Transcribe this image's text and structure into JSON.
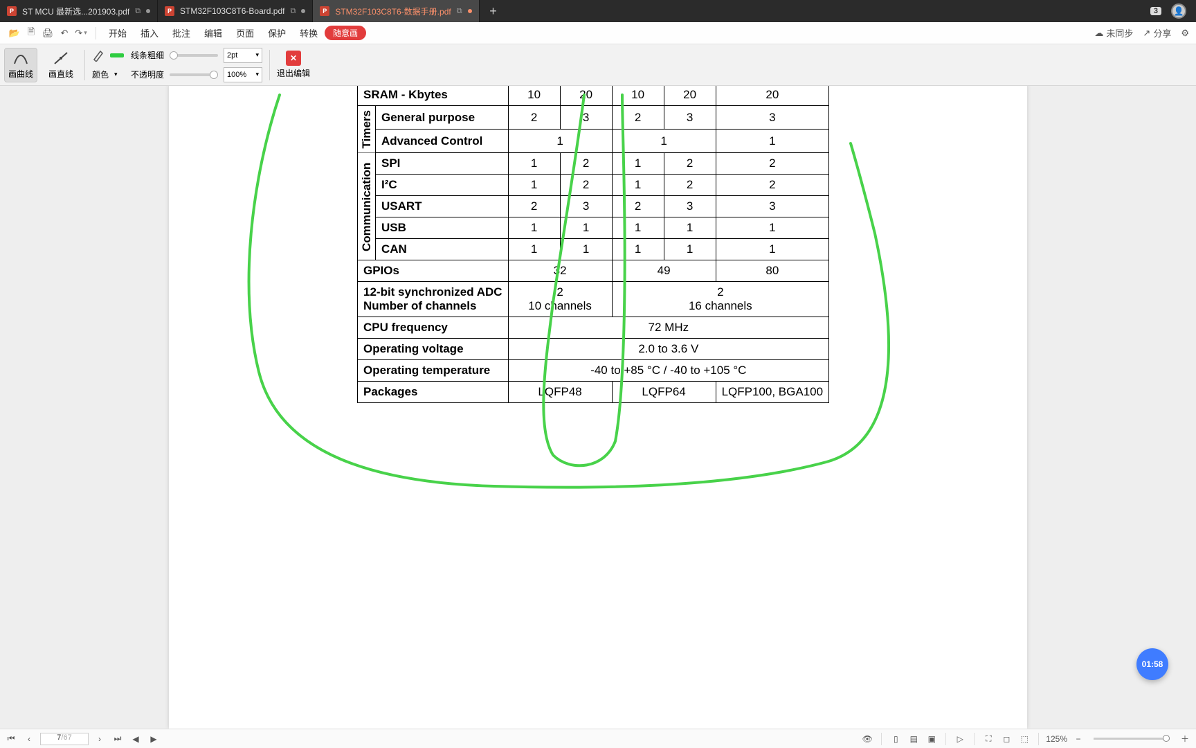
{
  "tabs": [
    {
      "label": "ST MCU 最新选...201903.pdf",
      "active": false,
      "modified": false
    },
    {
      "label": "STM32F103C8T6-Board.pdf",
      "active": false,
      "modified": false
    },
    {
      "label": "STM32F103C8T6-数据手册.pdf",
      "active": true,
      "modified": true
    }
  ],
  "titlebar_badge": "3",
  "menus": [
    "开始",
    "插入",
    "批注",
    "编辑",
    "页面",
    "保护",
    "转换"
  ],
  "pill": "随意画",
  "sync": "未同步",
  "share": "分享",
  "tools": {
    "curve": "画曲线",
    "line": "画直线",
    "color": "颜色",
    "opacity": "不透明度",
    "thickness_label": "线条粗细",
    "thickness": "2pt",
    "opacity_val": "100%",
    "exit": "退出编辑"
  },
  "table": {
    "sram": {
      "label": "SRAM - Kbytes",
      "v": [
        "10",
        "20",
        "10",
        "20",
        "20"
      ]
    },
    "timers_label": "Timers",
    "timers": [
      {
        "label": "General purpose",
        "v": [
          "2",
          "3",
          "2",
          "3",
          "3"
        ]
      },
      {
        "label": "Advanced Control",
        "v": [
          "1",
          "",
          "1",
          "",
          "1"
        ],
        "span": [
          2,
          0,
          1,
          0,
          1
        ],
        "merged": [
          true,
          false,
          false,
          false,
          false
        ]
      }
    ],
    "comm_label": "Communication",
    "comm": [
      {
        "label": "SPI",
        "v": [
          "1",
          "2",
          "1",
          "2",
          "2"
        ]
      },
      {
        "label": "I²C",
        "v": [
          "1",
          "2",
          "1",
          "2",
          "2"
        ]
      },
      {
        "label": "USART",
        "v": [
          "2",
          "3",
          "2",
          "3",
          "3"
        ]
      },
      {
        "label": "USB",
        "v": [
          "1",
          "1",
          "1",
          "1",
          "1"
        ]
      },
      {
        "label": "CAN",
        "v": [
          "1",
          "1",
          "1",
          "1",
          "1"
        ]
      }
    ],
    "gpios": {
      "label": "GPIOs",
      "v": [
        "32",
        "49",
        "80"
      ]
    },
    "adc": {
      "label1": "12-bit synchronized ADC",
      "label2": "Number of channels",
      "v1": [
        "2",
        "2"
      ],
      "v2": [
        "10 channels",
        "16 channels"
      ]
    },
    "cpu": {
      "label": "CPU frequency",
      "v": "72 MHz"
    },
    "ov": {
      "label": "Operating voltage",
      "v": "2.0 to 3.6 V"
    },
    "ot": {
      "label": "Operating temperature",
      "v": "-40 to +85 °C / -40 to +105 °C"
    },
    "pkg": {
      "label": "Packages",
      "v": [
        "LQFP48",
        "LQFP64",
        "LQFP100, BGA100"
      ]
    }
  },
  "timer_badge": "01:58",
  "status": {
    "page": "7",
    "pages": "67",
    "zoom": "125%"
  }
}
